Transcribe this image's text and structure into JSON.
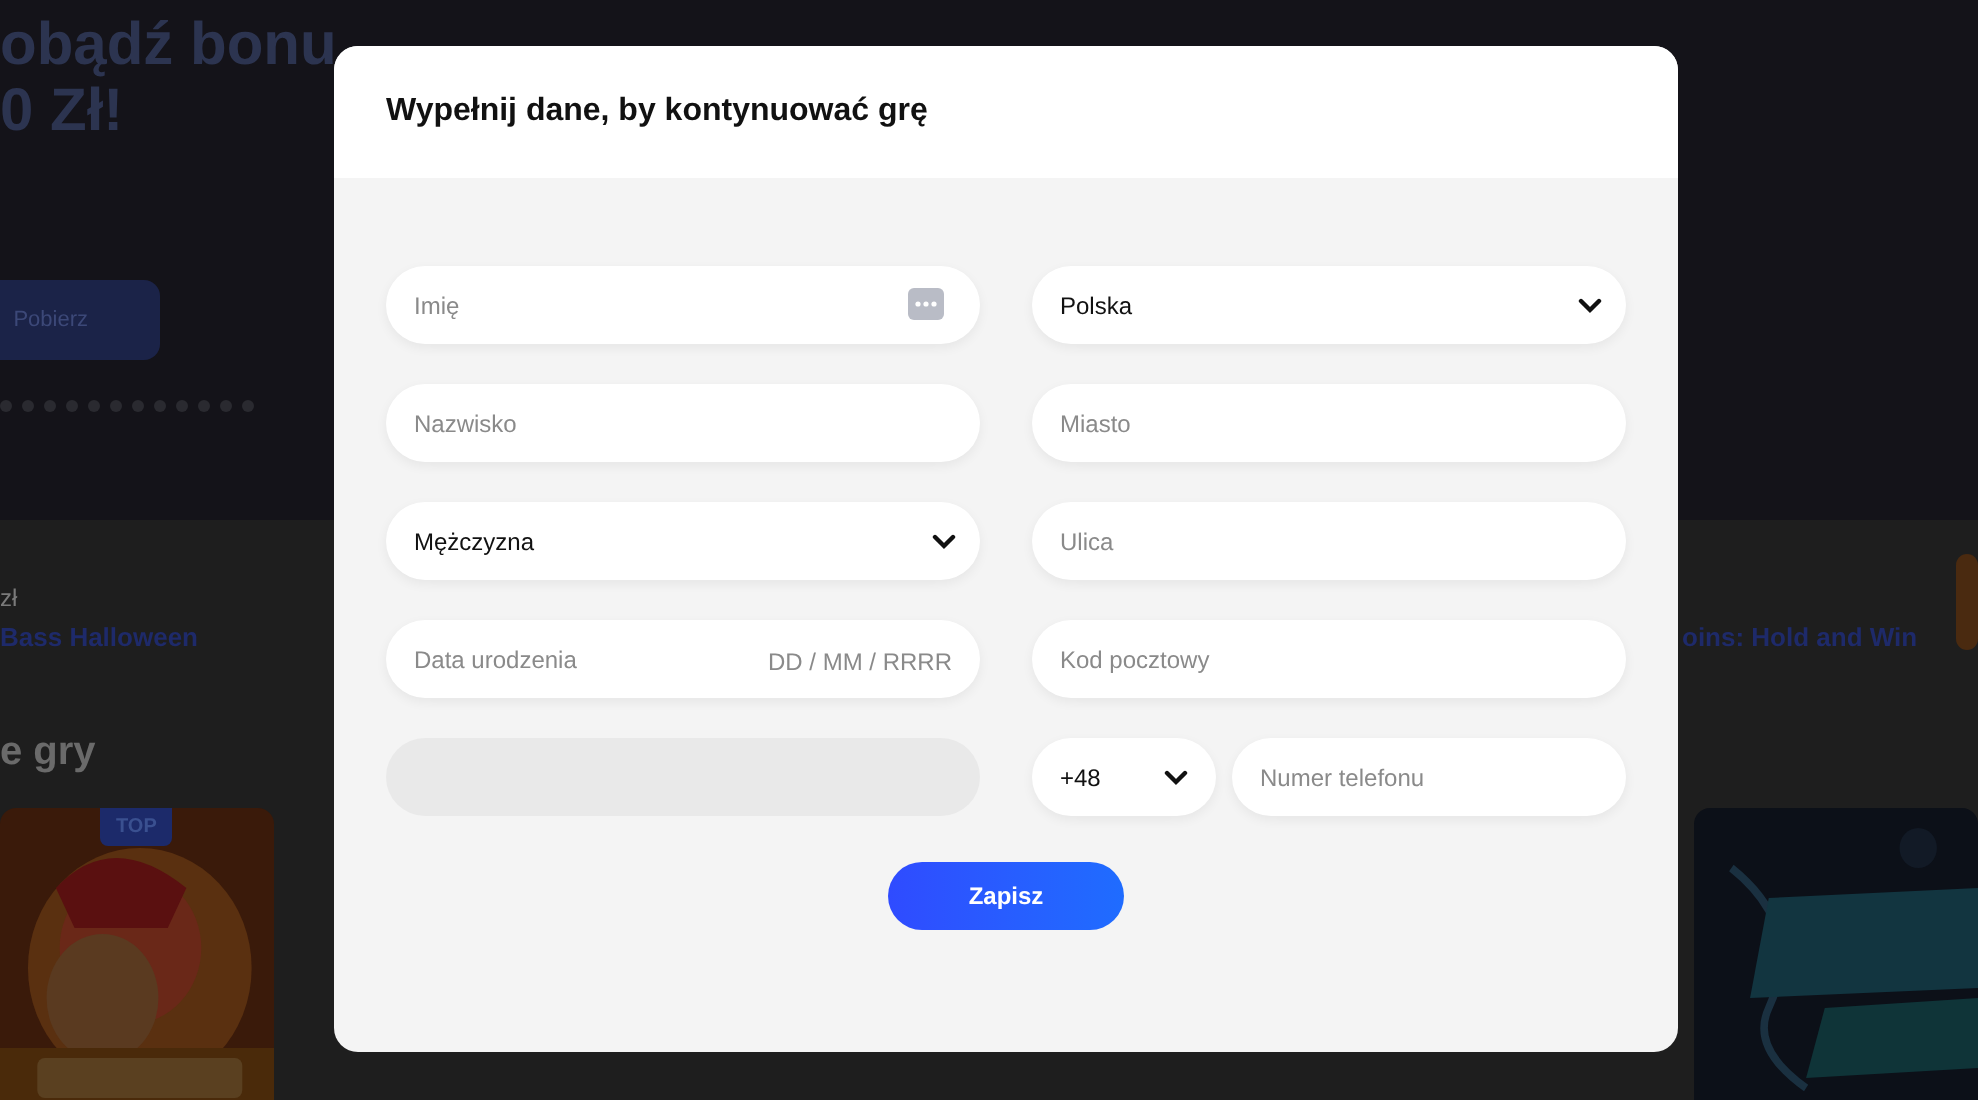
{
  "background": {
    "hero_title": [
      "obądź bonu",
      "0 Zł!"
    ],
    "hero_button": "Pobierz",
    "winner_amount": "zł",
    "winner_game": "Bass Halloween",
    "section_title": "e gry",
    "game_link": "oins: Hold and Win",
    "games": [
      {
        "kind": "picture",
        "badge": "TOP"
      },
      {
        "kind": "picture"
      }
    ]
  },
  "modal": {
    "title": "Wypełnij dane, by kontynuować grę",
    "left_fields": [
      {
        "kind": "text_icon",
        "placeholder": "Imię"
      },
      {
        "kind": "text",
        "placeholder": "Nazwisko"
      },
      {
        "kind": "select",
        "value": "Mężczyzna"
      },
      {
        "kind": "date",
        "placeholder": "Data urodzenia",
        "hint": "DD / MM / RRRR"
      },
      {
        "kind": "blank",
        "disabled": true
      }
    ],
    "right_fields": [
      {
        "kind": "select",
        "value": "Polska"
      },
      {
        "kind": "text",
        "placeholder": "Miasto"
      },
      {
        "kind": "text",
        "placeholder": "Ulica"
      },
      {
        "kind": "text",
        "placeholder": "Kod pocztowy"
      },
      {
        "kind": "phone",
        "code": "+48",
        "placeholder": "Numer telefonu"
      }
    ],
    "submit": "Zapisz"
  }
}
